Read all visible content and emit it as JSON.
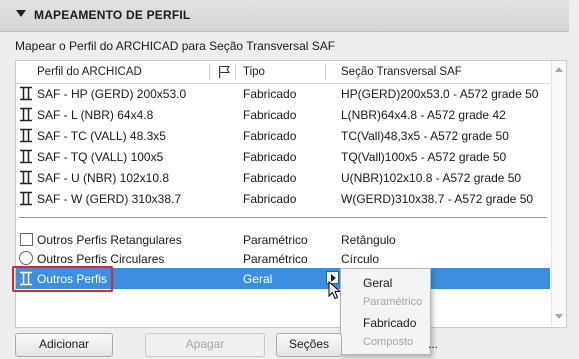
{
  "section": {
    "title": "MAPEAMENTO DE PERFIL"
  },
  "subtitle": "Mapear o Perfil do ARCHICAD para Seção Transversal SAF",
  "columns": {
    "profile": "Perfil do ARCHICAD",
    "type": "Tipo",
    "saf": "Seção Transversal SAF"
  },
  "rows": [
    {
      "profile": "SAF - HP (GERD) 200x53.0",
      "type": "Fabricado",
      "saf": "HP(GERD)200x53.0 - A572 grade 50"
    },
    {
      "profile": "SAF - L (NBR) 64x4.8",
      "type": "Fabricado",
      "saf": "L(NBR)64x4.8 - A572 grade 42"
    },
    {
      "profile": "SAF - TC (VALL) 48.3x5",
      "type": "Fabricado",
      "saf": "TC(Vall)48,3x5 - A572 grade 50"
    },
    {
      "profile": "SAF - TQ (VALL) 100x5",
      "type": "Fabricado",
      "saf": "TQ(Vall)100x5 - A572 grade 50"
    },
    {
      "profile": "SAF - U (NBR) 102x10.8",
      "type": "Fabricado",
      "saf": "U(NBR)102x10.8 - A572 grade 50"
    },
    {
      "profile": "SAF - W (GERD) 310x38.7",
      "type": "Fabricado",
      "saf": "W(GERD)310x38.7 - A572 grade 50"
    }
  ],
  "other_rows": {
    "rect": {
      "profile": "Outros Perfis Retangulares",
      "type": "Paramétrico",
      "saf": "Retângulo"
    },
    "circ": {
      "profile": "Outros Perfis Circulares",
      "type": "Paramétrico",
      "saf": "Círculo"
    },
    "other": {
      "profile": "Outros Perfis",
      "type": "Geral"
    }
  },
  "popup": {
    "options": [
      "Geral",
      "Paramétrico",
      "Fabricado",
      "Composto"
    ]
  },
  "buttons": {
    "add": "Adicionar",
    "delete": "Apagar",
    "sections": "Seções",
    "sections_tail": "..."
  },
  "colors": {
    "selection": "#3c8fe0",
    "highlight": "#e1262a"
  }
}
